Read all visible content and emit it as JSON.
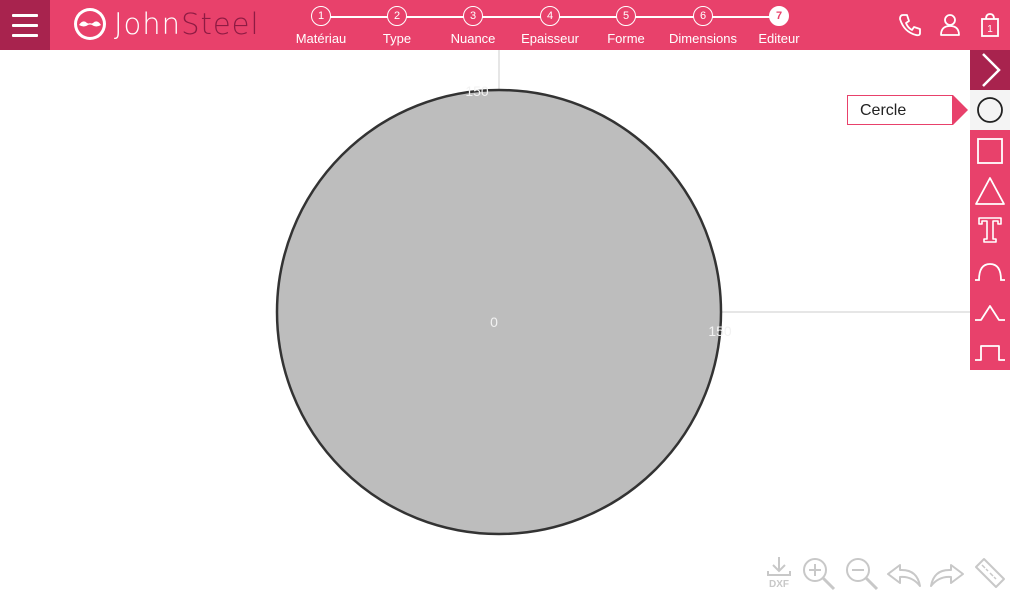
{
  "header": {
    "logo_part1": "John",
    "logo_part2": "Steel",
    "steps": [
      {
        "number": "1",
        "label": "Matériau"
      },
      {
        "number": "2",
        "label": "Type"
      },
      {
        "number": "3",
        "label": "Nuance"
      },
      {
        "number": "4",
        "label": "Epaisseur"
      },
      {
        "number": "5",
        "label": "Forme"
      },
      {
        "number": "6",
        "label": "Dimensions"
      },
      {
        "number": "7",
        "label": "Editeur"
      }
    ],
    "active_step": "7",
    "icons": [
      "phone-icon",
      "user-icon",
      "cart-icon"
    ],
    "cart_count": "1"
  },
  "canvas": {
    "shape": "circle",
    "center_label": "0",
    "top_label": "150",
    "right_label": "150",
    "fill_color": "#bdbdbd",
    "stroke_color": "#333333"
  },
  "toolbar": {
    "tooltip": "Cercle",
    "tools": [
      "circle-icon",
      "square-icon",
      "triangle-icon",
      "text-icon",
      "arc-notch-icon",
      "v-notch-icon",
      "rect-notch-icon"
    ]
  },
  "bottom_toolbar": {
    "dxf_label": "DXF",
    "icons": [
      "dxf-download-icon",
      "zoom-in-icon",
      "zoom-out-icon",
      "undo-icon",
      "redo-icon",
      "ruler-icon"
    ]
  },
  "colors": {
    "accent": "#e8416b",
    "accent_dark": "#a8234e",
    "logo_dark": "#8e1b43",
    "shape_fill": "#bdbdbd",
    "icon_gray": "#c8c8c8"
  }
}
